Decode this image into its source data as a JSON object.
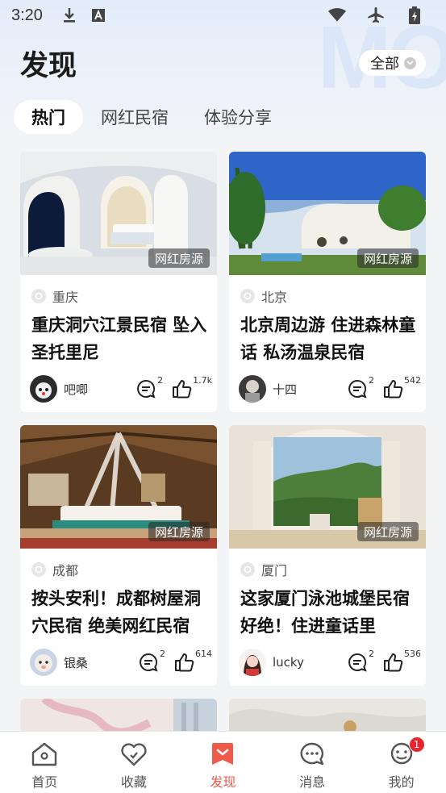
{
  "status_bar": {
    "time": "3:20",
    "icons": [
      "download-icon",
      "font-a-icon",
      "wifi-icon",
      "airplane-icon",
      "battery-icon"
    ]
  },
  "watermark": "MO",
  "header": {
    "title": "发现",
    "filter_label": "全部"
  },
  "tabs": [
    {
      "label": "热门",
      "active": true
    },
    {
      "label": "网红民宿",
      "active": false
    },
    {
      "label": "体验分享",
      "active": false
    }
  ],
  "cards": [
    {
      "tag": "网红房源",
      "location": "重庆",
      "title": "重庆洞穴江景民宿 坠入圣托里尼",
      "author": "吧唧",
      "comments": "2",
      "likes": "1.7k"
    },
    {
      "tag": "网红房源",
      "location": "北京",
      "title": "北京周边游 住进森林童话 私汤温泉民宿",
      "author": "十四",
      "comments": "2",
      "likes": "542"
    },
    {
      "tag": "网红房源",
      "location": "成都",
      "title": "按头安利！成都树屋洞穴民宿 绝美网红民宿",
      "author": "银桑",
      "comments": "2",
      "likes": "614"
    },
    {
      "tag": "网红房源",
      "location": "厦门",
      "title": "这家厦门泳池城堡民宿好绝！住进童话里",
      "author": "lucky",
      "comments": "2",
      "likes": "536"
    }
  ],
  "bottom_nav": [
    {
      "label": "首页",
      "icon": "home-icon",
      "active": false
    },
    {
      "label": "收藏",
      "icon": "heart-icon",
      "active": false
    },
    {
      "label": "发现",
      "icon": "discover-icon",
      "active": true
    },
    {
      "label": "消息",
      "icon": "message-icon",
      "active": false
    },
    {
      "label": "我的",
      "icon": "profile-icon",
      "active": false,
      "badge": "1"
    }
  ],
  "colors": {
    "accent": "#f05a4b",
    "badge": "#e8242c"
  }
}
